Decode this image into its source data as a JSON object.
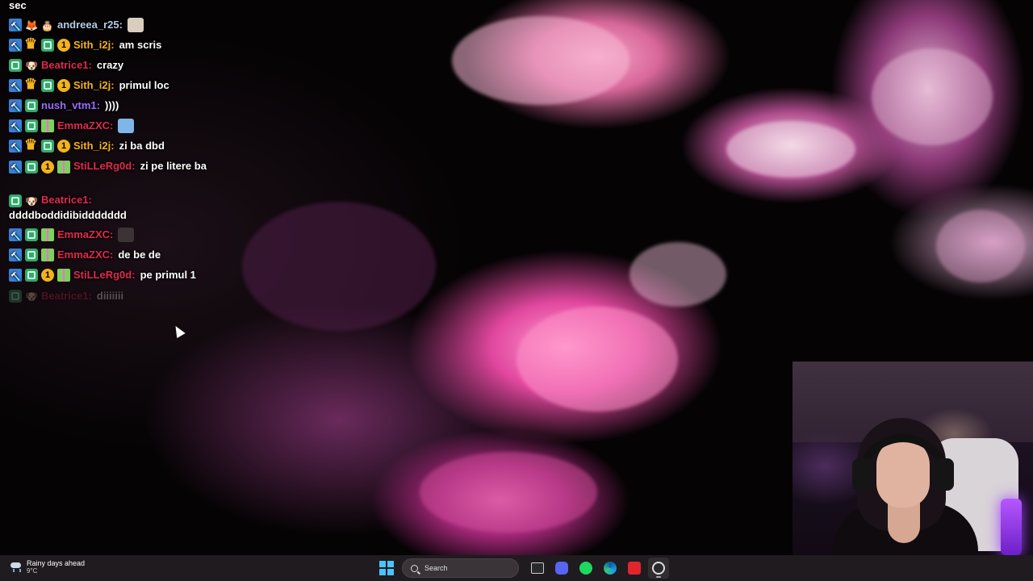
{
  "chat": {
    "top_line": "sec",
    "messages": [
      {
        "user": "andreea_r25:",
        "text": "",
        "user_color": "#b7c9e8"
      },
      {
        "user": "Sith_i2j:",
        "text": "am scris",
        "user_color": "#f5b21e"
      },
      {
        "user": "Beatrice1:",
        "text": "crazy",
        "user_color": "#e02a4f"
      },
      {
        "user": "Sith_i2j:",
        "text": "primul loc",
        "user_color": "#f5b21e"
      },
      {
        "user": "nush_vtm1:",
        "text": "))))",
        "user_color": "#9b6cff"
      },
      {
        "user": "EmmaZXC:",
        "text": "",
        "user_color": "#e02a4f"
      },
      {
        "user": "Sith_i2j:",
        "text": "zi ba dbd",
        "user_color": "#f5b21e"
      },
      {
        "user": "StiLLeRg0d:",
        "text": "zi pe litere ba",
        "user_color": "#e02a4f"
      },
      {
        "user": "Beatrice1:",
        "text": "ddddboddidibiddddddd",
        "user_color": "#e02a4f"
      },
      {
        "user": "EmmaZXC:",
        "text": "",
        "user_color": "#e02a4f"
      },
      {
        "user": "EmmaZXC:",
        "text": "de be de",
        "user_color": "#e02a4f"
      },
      {
        "user": "StiLLeRg0d:",
        "text": "pe primul 1",
        "user_color": "#e02a4f"
      },
      {
        "user": "Beatrice1:",
        "text": "diiiiiii",
        "user_color": "#e02a4f"
      }
    ]
  },
  "taskbar": {
    "weather_title": "Rainy days ahead",
    "weather_temp": "9°C",
    "search_placeholder": "Search",
    "apps": [
      "task-view-icon",
      "discord-icon",
      "spotify-icon",
      "edge-icon",
      "red-app-icon",
      "obs-icon"
    ],
    "accent_color": "#4cc2ff"
  }
}
